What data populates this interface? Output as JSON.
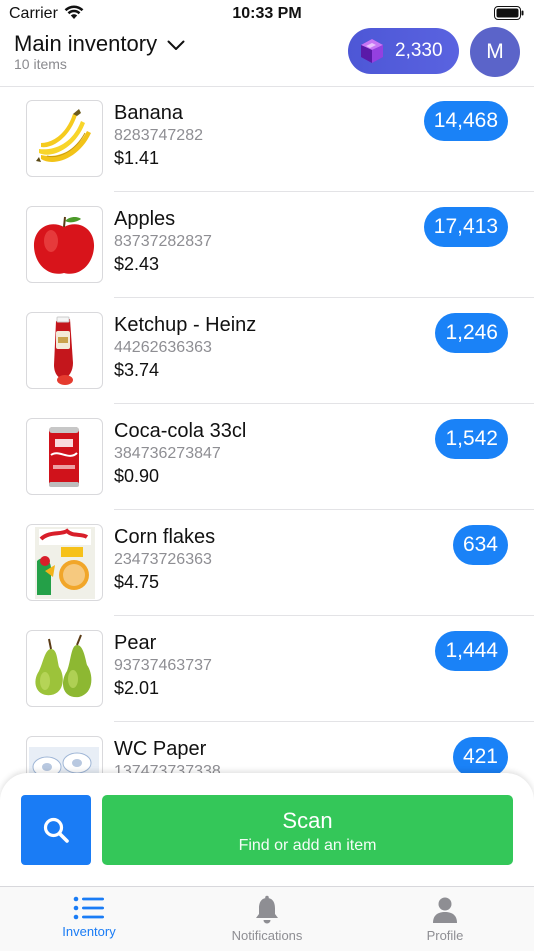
{
  "status_bar": {
    "carrier": "Carrier",
    "time": "10:33 PM"
  },
  "header": {
    "title": "Main inventory",
    "subtitle": "10 items",
    "gem_count": "2,330",
    "avatar_initial": "M"
  },
  "items": [
    {
      "name": "Banana",
      "code": "8283747282",
      "price": "$1.41",
      "quantity": "14,468",
      "image": "banana"
    },
    {
      "name": "Apples",
      "code": "83737282837",
      "price": "$2.43",
      "quantity": "17,413",
      "image": "apple"
    },
    {
      "name": "Ketchup - Heinz",
      "code": "44262636363",
      "price": "$3.74",
      "quantity": "1,246",
      "image": "ketchup"
    },
    {
      "name": "Coca-cola 33cl",
      "code": "384736273847",
      "price": "$0.90",
      "quantity": "1,542",
      "image": "cola-can"
    },
    {
      "name": "Corn flakes",
      "code": "23473726363",
      "price": "$4.75",
      "quantity": "634",
      "image": "cereal-box"
    },
    {
      "name": "Pear",
      "code": "93737463737",
      "price": "$2.01",
      "quantity": "1,444",
      "image": "pear"
    },
    {
      "name": "WC Paper",
      "code": "137473737338",
      "price": "",
      "quantity": "421",
      "image": "toilet-paper"
    }
  ],
  "actions": {
    "search_icon": "magnifier-icon",
    "scan_title": "Scan",
    "scan_subtitle": "Find or add an item"
  },
  "tabs": [
    {
      "label": "Inventory",
      "icon": "list-icon",
      "active": true
    },
    {
      "label": "Notifications",
      "icon": "bell-icon",
      "active": false
    },
    {
      "label": "Profile",
      "icon": "person-icon",
      "active": false
    }
  ],
  "colors": {
    "accent_blue": "#1a82f7",
    "scan_green": "#34c759",
    "gem_purple": "#4d57d6",
    "avatar": "#5b64c9"
  }
}
